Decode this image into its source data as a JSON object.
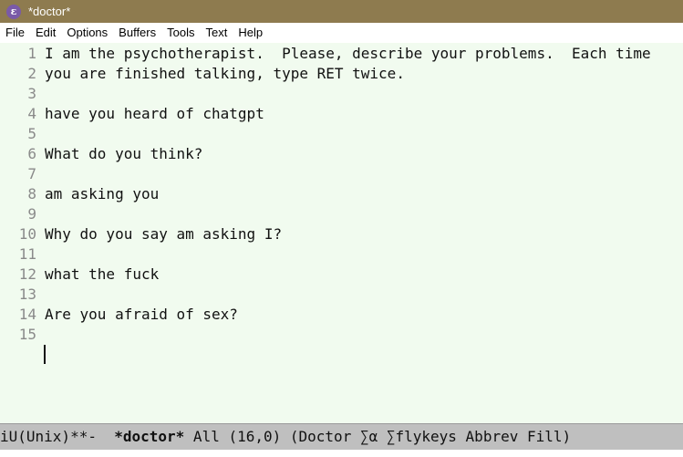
{
  "window": {
    "title": "*doctor*",
    "icon": "emacs-icon",
    "icon_glyph": "ε"
  },
  "menubar": {
    "items": [
      {
        "label": "File"
      },
      {
        "label": "Edit"
      },
      {
        "label": "Options"
      },
      {
        "label": "Buffers"
      },
      {
        "label": "Tools"
      },
      {
        "label": "Text"
      },
      {
        "label": "Help"
      }
    ]
  },
  "buffer": {
    "lines": [
      {
        "num": "1",
        "text": "I am the psychotherapist.  Please, describe your problems.  Each time"
      },
      {
        "num": "2",
        "text": "you are finished talking, type RET twice."
      },
      {
        "num": "3",
        "text": ""
      },
      {
        "num": "4",
        "text": "have you heard of chatgpt"
      },
      {
        "num": "5",
        "text": ""
      },
      {
        "num": "6",
        "text": "What do you think?"
      },
      {
        "num": "7",
        "text": ""
      },
      {
        "num": "8",
        "text": "am asking you"
      },
      {
        "num": "9",
        "text": ""
      },
      {
        "num": "10",
        "text": "Why do you say am asking I?"
      },
      {
        "num": "11",
        "text": ""
      },
      {
        "num": "12",
        "text": "what the fuck"
      },
      {
        "num": "13",
        "text": ""
      },
      {
        "num": "14",
        "text": "Are you afraid of sex?"
      },
      {
        "num": "15",
        "text": ""
      }
    ]
  },
  "modeline": {
    "prefix": "iU(Unix)**-  ",
    "buffer_name": "*doctor*",
    "suffix": " All (16,0) (Doctor ∑α ∑flykeys Abbrev Fill)"
  },
  "colors": {
    "titlebar": "#8e7b4f",
    "editor_bg": "#f1fbef",
    "modeline_bg": "#bfbfbf",
    "line_number": "#8a8a8a"
  }
}
